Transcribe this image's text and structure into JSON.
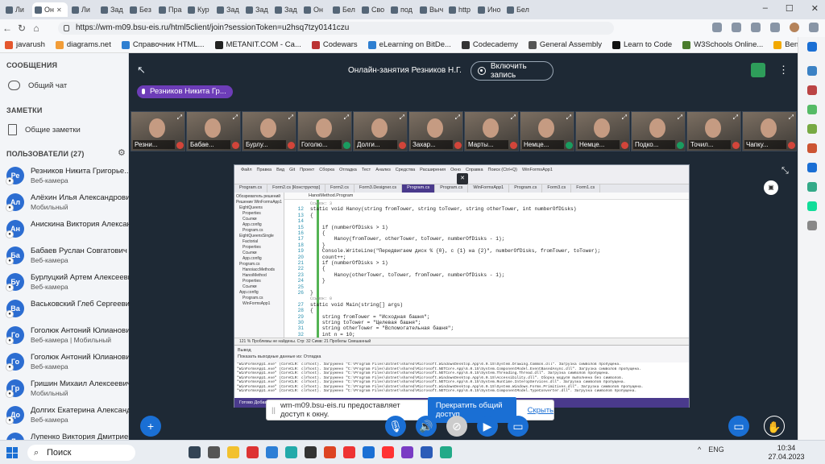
{
  "browser": {
    "tabs": [
      {
        "label": "Ли"
      },
      {
        "label": "Он",
        "active": true
      },
      {
        "label": "Ли"
      },
      {
        "label": "Зад"
      },
      {
        "label": "Без"
      },
      {
        "label": "Пра"
      },
      {
        "label": "Кур"
      },
      {
        "label": "Зад"
      },
      {
        "label": "Зад"
      },
      {
        "label": "Зад"
      },
      {
        "label": "Он"
      },
      {
        "label": "Бел"
      },
      {
        "label": "Сво"
      },
      {
        "label": "под"
      },
      {
        "label": "Выч"
      },
      {
        "label": "http"
      },
      {
        "label": "Ино"
      },
      {
        "label": "Бел"
      }
    ],
    "url": "https://wm-m09.bsu-eis.ru/html5client/join?sessionToken=u2hsq7tzy0141czu",
    "bookmarks": [
      "javarush",
      "diagrams.net",
      "Справочник HTML...",
      "METANIT.COM - Са...",
      "Codewars",
      "eLearning on BitDe...",
      "Codecademy",
      "General Assembly",
      "Learn to Code",
      "W3Schools Online...",
      "Bento - Topics"
    ],
    "bookmark_colors": [
      "#e4572e",
      "#f29d38",
      "#2f7fd1",
      "#222",
      "#b33",
      "#2f7fd1",
      "#333",
      "#555",
      "#111",
      "#4a7c2c",
      "#f2a900"
    ]
  },
  "left": {
    "messages_header": "СООБЩЕНИЯ",
    "public_chat": "Общий чат",
    "notes_header": "ЗАМЕТКИ",
    "shared_notes": "Общие заметки",
    "users_header": "ПОЛЬЗОВАТЕЛИ (27)",
    "users": [
      {
        "initials": "Ре",
        "name": "Резников Никита Григорье... (Вы)",
        "status": "Веб-камера",
        "color": "#2c6dd1"
      },
      {
        "initials": "Ал",
        "name": "Алёхин Илья Александрович",
        "status": "Мобильный",
        "color": "#2c6dd1"
      },
      {
        "initials": "Ан",
        "name": "Анискина Виктория Александр...",
        "status": "",
        "color": "#2c6dd1"
      },
      {
        "initials": "Ба",
        "name": "Бабаев Руслан Совгатович",
        "status": "Веб-камера",
        "color": "#2c6dd1"
      },
      {
        "initials": "Бу",
        "name": "Бурлуцкий Артем Алексеевич",
        "status": "Веб-камера",
        "color": "#2c6dd1"
      },
      {
        "initials": "Ва",
        "name": "Васьковский Глеб Сергеевич",
        "status": "",
        "color": "#2c6dd1"
      },
      {
        "initials": "Го",
        "name": "Гоголюк Антоний Юлианович",
        "status": "Веб-камера | Мобильный",
        "color": "#2c6dd1"
      },
      {
        "initials": "Го",
        "name": "Гоголюк Антоний Юлианович",
        "status": "Веб-камера",
        "color": "#2c6dd1"
      },
      {
        "initials": "Гр",
        "name": "Гришин Михаил Алексеевич",
        "status": "Мобильный",
        "color": "#2c6dd1"
      },
      {
        "initials": "До",
        "name": "Долгих Екатерина Александро...",
        "status": "Веб-камера",
        "color": "#2c6dd1"
      },
      {
        "initials": "Лу",
        "name": "Лупенко Виктория Дмитриевна",
        "status": "",
        "color": "#2c6dd1"
      }
    ]
  },
  "main": {
    "title": "Онлайн-занятия Резников Н.Г.",
    "record_label": "Включить запись",
    "presenter": "Резников Никита Гр...",
    "webcams": [
      "Резни...",
      "Бабае...",
      "Бурлу...",
      "Гоголю...",
      "Долги...",
      "Захар...",
      "Марты...",
      "Немце...",
      "Немце...",
      "Подко...",
      "Точил...",
      "Чапку..."
    ],
    "webcam_mic_on": [
      false,
      false,
      false,
      true,
      false,
      false,
      false,
      true,
      false,
      true,
      false,
      false
    ],
    "share_notice": "wm-m09.bsu-eis.ru предоставляет доступ к окну.",
    "stop_share": "Прекратить общий доступ",
    "hide": "Скрыть"
  },
  "vs": {
    "menu": [
      "Файл",
      "Правка",
      "Вид",
      "Git",
      "Проект",
      "Сборка",
      "Отладка",
      "Тест",
      "Анализ",
      "Средства",
      "Расширения",
      "Окно",
      "Справка",
      "Поиск (Ctrl+Q)",
      "WinFormsApp1"
    ],
    "tabs": [
      "Program.cs",
      "Form2.cs [Конструктор]",
      "Form2.cs",
      "Form3.Designer.cs",
      "Program.cs",
      "Program.cs",
      "WinFormsApp1",
      "Program.cs",
      "Form3.cs",
      "Form1.cs"
    ],
    "nav": "HanoiMethod.Program",
    "solution": [
      "Обозреватель решений",
      "Решение WinFormsApp1",
      "EightQueens",
      "Properties",
      "Ссылки",
      "App.config",
      "Program.cs",
      "EightQueensSingle",
      "Factorial",
      "Properties",
      "Ссылки",
      "App.config",
      "Program.cs",
      "HanoiaccMethods",
      "HanoiMethod",
      "Properties",
      "Ссылки",
      "App.config",
      "Program.cs",
      "WinFormsApp1"
    ],
    "code": [
      {
        "n": "",
        "t": "Ссылок: 3"
      },
      {
        "n": "12",
        "t": "static void Hanoy(string fromTower, string toTower, string otherTower, int numberOfDisks)"
      },
      {
        "n": "13",
        "t": "{"
      },
      {
        "n": "14",
        "t": ""
      },
      {
        "n": "15",
        "t": "    if (numberOfDisks > 1)"
      },
      {
        "n": "16",
        "t": "    {"
      },
      {
        "n": "17",
        "t": "        Hanoy(fromTower, otherTower, toTower, numberOfDisks - 1);"
      },
      {
        "n": "18",
        "t": "    }"
      },
      {
        "n": "19",
        "t": "    Console.WriteLine(\"Передвигаем диск % {0}, с {1} на {2}\", numberOfDisks, fromTower, toTower);"
      },
      {
        "n": "20",
        "t": "    count++;"
      },
      {
        "n": "21",
        "t": "    if (numberOfDisks > 1)"
      },
      {
        "n": "22",
        "t": "    {"
      },
      {
        "n": "23",
        "t": "        Hanoy(otherTower, toTower, fromTower, numberOfDisks - 1);"
      },
      {
        "n": "24",
        "t": "    }"
      },
      {
        "n": "25",
        "t": ""
      },
      {
        "n": "26",
        "t": "}"
      },
      {
        "n": "",
        "t": "Ссылок: 0"
      },
      {
        "n": "27",
        "t": "static void Main(string[] args)"
      },
      {
        "n": "28",
        "t": "{"
      },
      {
        "n": "29",
        "t": "    string fromTower = \"Исходная башня\";"
      },
      {
        "n": "30",
        "t": "    string toTower = \"Целевая башня\";"
      },
      {
        "n": "31",
        "t": "    string otherTower = \"Вспомогательная башня\";"
      },
      {
        "n": "32",
        "t": "    int n = 10;"
      }
    ],
    "status": "121 %   Проблемы не найдены.                                  Стр: 32   Симв: 21   Пробелы   Смешанный",
    "output_title": "Вывод",
    "output_source": "Показать выходные данные из:   Отладка",
    "output": [
      "\"WinFormsApp1.exe\" (CoreCLR: clrhost). Загружено \"C:\\Program Files\\dotnet\\shared\\Microsoft.WindowsDesktop.App\\6.0.15\\System.Drawing.Common.dll\". Загрузка символов пропущена.",
      "\"WinFormsApp1.exe\" (CoreCLR: clrhost). Загружено \"C:\\Program Files\\dotnet\\shared\\Microsoft.NETCore.App\\6.0.15\\System.ComponentModel.EventBasedAsync.dll\". Загрузка символов пропущена.",
      "\"WinFormsApp1.exe\" (CoreCLR: clrhost). Загружено \"C:\\Program Files\\dotnet\\shared\\Microsoft.NETCore.App\\6.0.15\\System.Threading.Thread.dll\". Загрузка символов пропущена.",
      "\"WinFormsApp1.exe\" (CoreCLR: clrhost). Загружено \"C:\\Program Files\\dotnet\\shared\\Microsoft.WindowsDesktop.App\\6.0.15\\Accessibility.dll\". Сборка модуля выполнена без символов.",
      "\"WinFormsApp1.exe\" (CoreCLR: clrhost). Загружено \"C:\\Program Files\\dotnet\\shared\\Microsoft.NETCore.App\\6.0.15\\System.Runtime.InteropServices.dll\". Загрузка символов пропущена.",
      "\"WinFormsApp1.exe\" (CoreCLR: clrhost). Загружено \"C:\\Program Files\\dotnet\\shared\\Microsoft.WindowsDesktop.App\\6.0.15\\System.Windows.Forms.Primitives.dll\". Загрузка символов пропущена.",
      "\"WinFormsApp1.exe\" (CoreCLR: clrhost). Загружено \"C:\\Program Files\\dotnet\\shared\\Microsoft.NETCore.App\\6.0.15\\System.ComponentModel.TypeConverter.dll\". Загрузка символов пропущена."
    ],
    "bottom": "Готово                                                                                          Добавить в систему управления версиями   Выбрать репозиторий"
  },
  "taskbar": {
    "search": "Поиск",
    "lang": "ENG",
    "time": "10:34",
    "date": "27.04.2023"
  }
}
